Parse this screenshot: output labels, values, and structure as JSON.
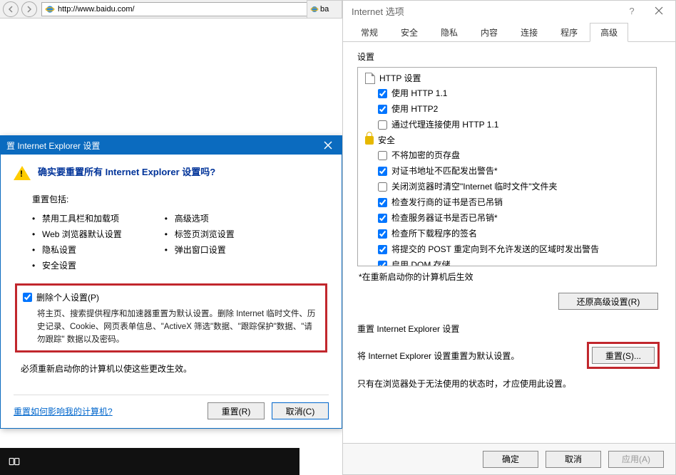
{
  "browser": {
    "url": "http://www.baidu.com/",
    "tab_fragment_label": "ba"
  },
  "reset_dialog": {
    "title": "置 Internet Explorer 设置",
    "heading": "确实要重置所有 Internet Explorer 设置吗?",
    "includes_label": "重置包括:",
    "left_items": [
      "禁用工具栏和加载项",
      "Web 浏览器默认设置",
      "隐私设置",
      "安全设置"
    ],
    "right_items": [
      "高级选项",
      "标签页浏览设置",
      "弹出窗口设置"
    ],
    "delete_personal_label": "删除个人设置(P)",
    "delete_personal_desc": "将主页、搜索提供程序和加速器重置为默认设置。删除 Internet 临时文件、历史记录、Cookie、网页表单信息、\"ActiveX 筛选\"数据、\"跟踪保护\"数据、\"请勿跟踪\" 数据以及密码。",
    "reboot_note": "必须重新启动你的计算机以使这些更改生效。",
    "help_link": "重置如何影响我的计算机?",
    "reset_btn": "重置(R)",
    "cancel_btn": "取消(C)"
  },
  "options_dialog": {
    "title": "Internet 选项",
    "tabs": [
      "常规",
      "安全",
      "隐私",
      "内容",
      "连接",
      "程序",
      "高级"
    ],
    "active_tab": "高级",
    "settings_label": "设置",
    "http_group": "HTTP 设置",
    "http_items": [
      {
        "label": "使用 HTTP 1.1",
        "checked": true
      },
      {
        "label": "使用 HTTP2",
        "checked": true
      },
      {
        "label": "通过代理连接使用 HTTP 1.1",
        "checked": false
      }
    ],
    "security_group": "安全",
    "security_items": [
      {
        "label": "不将加密的页存盘",
        "checked": false
      },
      {
        "label": "对证书地址不匹配发出警告*",
        "checked": true
      },
      {
        "label": "关闭浏览器时清空\"Internet 临时文件\"文件夹",
        "checked": false
      },
      {
        "label": "检查发行商的证书是否已吊销",
        "checked": true
      },
      {
        "label": "检查服务器证书是否已吊销*",
        "checked": true
      },
      {
        "label": "检查所下载程序的签名",
        "checked": true
      },
      {
        "label": "将提交的 POST 重定向到不允许发送的区域时发出警告",
        "checked": true
      },
      {
        "label": "启用 DOM 存储",
        "checked": true
      }
    ],
    "restart_note": "*在重新启动你的计算机后生效",
    "restore_btn": "还原高级设置(R)",
    "reset_section_title": "重置 Internet Explorer 设置",
    "reset_desc": "将 Internet Explorer 设置重置为默认设置。",
    "reset_btn": "重置(S)...",
    "reset_caveat": "只有在浏览器处于无法使用的状态时，才应使用此设置。",
    "ok_btn": "确定",
    "cancel_btn": "取消",
    "apply_btn": "应用(A)"
  }
}
